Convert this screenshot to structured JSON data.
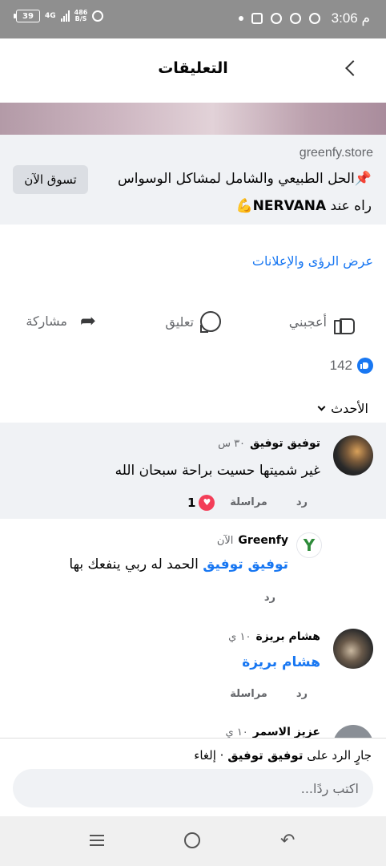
{
  "status_bar": {
    "battery": "39",
    "network": "4G",
    "speed": "486",
    "speed_unit": "B/S",
    "time": "3:06 م"
  },
  "header": {
    "title": "التعليقات",
    "back_icon": "chevron-right-icon"
  },
  "ad": {
    "domain": "greenfy.store",
    "pin_icon": "📌",
    "text": "الحل الطبيعي والشامل لمشاكل الوسواس راه عند ",
    "brand": "NERVANA",
    "muscle_icon": "💪",
    "cta": "تسوق الآن"
  },
  "insights_link": "عرض الرؤى والإعلانات",
  "actions": {
    "like": "أعجبني",
    "comment": "تعليق",
    "share": "مشاركة"
  },
  "reactions": {
    "count": "142",
    "color": "#1877f2"
  },
  "sort": {
    "label": "الأحدث"
  },
  "comments": [
    {
      "name": "توفيق توفيق",
      "time": "٣٠ س",
      "text": "غير شميتها حسيت براحة سبحان الله",
      "reply": "رد",
      "message": "مراسلة",
      "heart_count": "1",
      "highlighted": true
    },
    {
      "name": "Greenfy",
      "time": "الآن",
      "mention": "توفيق توفيق",
      "text": " الحمد له ربي ينفعك بها",
      "reply": "رد",
      "avatar_letter": "Y"
    },
    {
      "name": "هشام بريزة",
      "time": "١٠ ي",
      "mention": "هشام بريزة",
      "reply": "رد",
      "message": "مراسلة"
    },
    {
      "name": "عزيز الاسمر",
      "time": "١٠ ي"
    }
  ],
  "reply_bar": {
    "prefix": "جارٍ الرد على",
    "target": "توفيق توفيق",
    "separator": "·",
    "cancel": "إلغاء",
    "placeholder": "اكتب ردًا..."
  },
  "nav": {
    "menu_icon": "recent-apps-icon",
    "home_icon": "home-icon",
    "back_icon": "back-icon"
  }
}
